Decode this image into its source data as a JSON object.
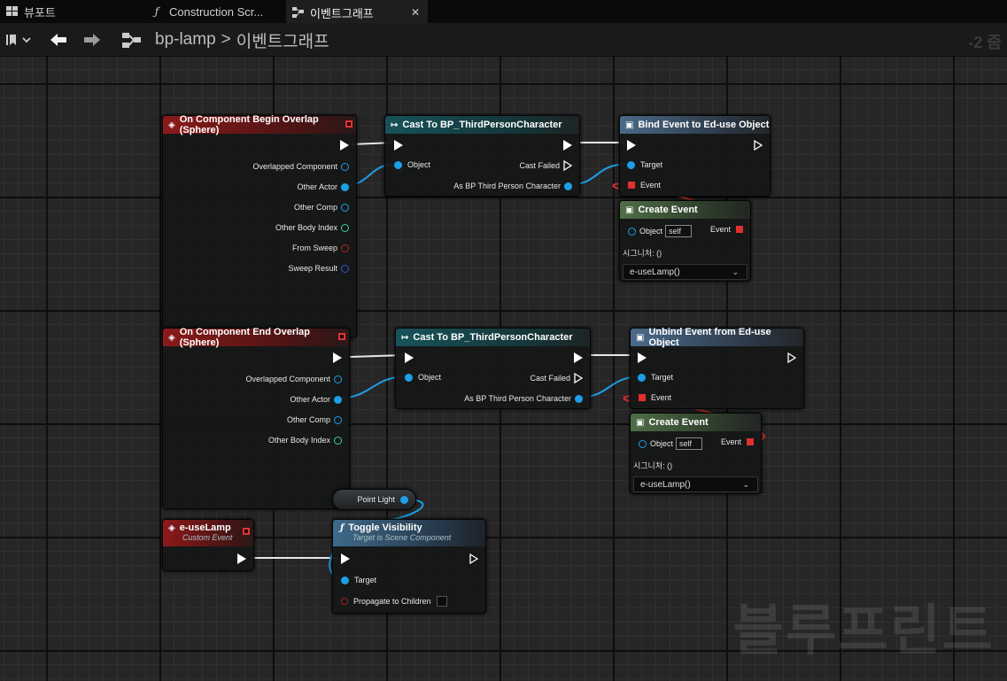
{
  "tabs": [
    {
      "label": "뷰포트",
      "icon": "viewport-grid-icon"
    },
    {
      "label": "Construction Scr...",
      "icon": "function-icon"
    },
    {
      "label": "이벤트그래프",
      "icon": "event-graph-icon"
    }
  ],
  "toolbar": {
    "breadcrumb_root": "bp-lamp",
    "breadcrumb_sep": ">",
    "breadcrumb_leaf": "이벤트그래프",
    "zoom": "-2 줌"
  },
  "watermark": "블루프린트",
  "nodes": {
    "begin_overlap": {
      "title": "On Component Begin Overlap (Sphere)",
      "pins": [
        "Overlapped Component",
        "Other Actor",
        "Other Comp",
        "Other Body Index",
        "From Sweep",
        "Sweep Result"
      ]
    },
    "cast1": {
      "title": "Cast To BP_ThirdPersonCharacter",
      "object": "Object",
      "cast_failed": "Cast Failed",
      "as_bp": "As BP Third Person Character"
    },
    "bind": {
      "title": "Bind Event to Ed-use Object",
      "target": "Target",
      "event": "Event"
    },
    "create1": {
      "title": "Create Event",
      "object": "Object",
      "self": "self",
      "event": "Event",
      "signature": "시그니처: ()",
      "function": "e-useLamp()"
    },
    "end_overlap": {
      "title": "On Component End Overlap (Sphere)",
      "pins": [
        "Overlapped Component",
        "Other Actor",
        "Other Comp",
        "Other Body Index"
      ]
    },
    "cast2": {
      "title": "Cast To BP_ThirdPersonCharacter",
      "object": "Object",
      "cast_failed": "Cast Failed",
      "as_bp": "As BP Third Person Character"
    },
    "unbind": {
      "title": "Unbind Event from Ed-use Object",
      "target": "Target",
      "event": "Event"
    },
    "create2": {
      "title": "Create Event",
      "object": "Object",
      "self": "self",
      "event": "Event",
      "signature": "시그니처: ()",
      "function": "e-useLamp()"
    },
    "custom": {
      "title": "e-useLamp",
      "subtitle": "Custom Event"
    },
    "pointlight": {
      "label": "Point Light"
    },
    "toggle": {
      "title": "Toggle Visibility",
      "subtitle": "Target is Scene Component",
      "target": "Target",
      "propagate": "Propagate to Children"
    }
  }
}
